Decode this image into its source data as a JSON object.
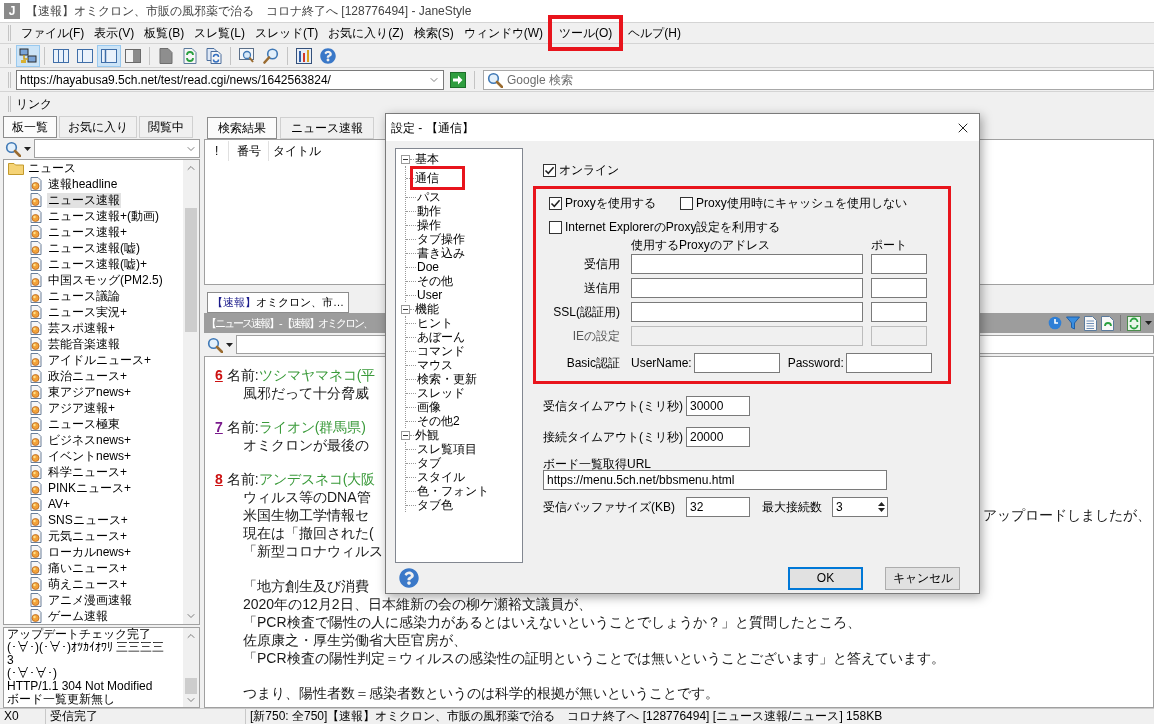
{
  "window": {
    "icon_letter": "J",
    "title": "【速報】オミクロン、市販の風邪薬で治る　コロナ終了へ [128776494] - JaneStyle"
  },
  "menu": [
    {
      "label": "ファイル(F)",
      "highlighted": false
    },
    {
      "label": "表示(V)",
      "highlighted": false
    },
    {
      "label": "板覧(B)",
      "highlighted": false
    },
    {
      "label": "スレ覧(L)",
      "highlighted": false
    },
    {
      "label": "スレッド(T)",
      "highlighted": false
    },
    {
      "label": "お気に入り(Z)",
      "highlighted": false
    },
    {
      "label": "検索(S)",
      "highlighted": false
    },
    {
      "label": "ウィンドウ(W)",
      "highlighted": false
    },
    {
      "label": "ツール(O)",
      "highlighted": true
    },
    {
      "label": "ヘルプ(H)",
      "highlighted": false
    }
  ],
  "toolbar": [
    [
      {
        "kind": "connect",
        "pressed": true
      }
    ],
    [
      {
        "kind": "three-pane",
        "pressed": false
      },
      {
        "kind": "two-pane",
        "pressed": false
      },
      {
        "kind": "pane",
        "pressed": true
      },
      {
        "kind": "split",
        "pressed": false
      }
    ],
    [
      {
        "kind": "document",
        "pressed": false
      },
      {
        "kind": "reload",
        "pressed": false
      },
      {
        "kind": "reload-all",
        "pressed": false
      }
    ],
    [
      {
        "kind": "window-search",
        "pressed": false
      },
      {
        "kind": "search",
        "pressed": false
      }
    ],
    [
      {
        "kind": "bars",
        "pressed": false
      },
      {
        "kind": "help",
        "pressed": false
      }
    ]
  ],
  "address": {
    "url": "https://hayabusa9.5ch.net/test/read.cgi/news/1642563824/"
  },
  "search": {
    "placeholder": "Google 検索"
  },
  "links_bar": {
    "label": "リンク"
  },
  "sidebar": {
    "tabs": [
      {
        "label": "板一覧",
        "selected": true
      },
      {
        "label": "お気に入り",
        "selected": false
      },
      {
        "label": "閲覧中",
        "selected": false
      }
    ],
    "tree": {
      "label": "ニュース",
      "children": [
        {
          "label": "速報headline",
          "selected": false
        },
        {
          "label": "ニュース速報",
          "selected": true
        },
        {
          "label": "ニュース速報+(動画)",
          "selected": false
        },
        {
          "label": "ニュース速報+",
          "selected": false
        },
        {
          "label": "ニュース速報(嘘)",
          "selected": false
        },
        {
          "label": "ニュース速報(嘘)+",
          "selected": false
        },
        {
          "label": "中国スモッグ(PM2.5)",
          "selected": false
        },
        {
          "label": "ニュース議論",
          "selected": false
        },
        {
          "label": "ニュース実況+",
          "selected": false
        },
        {
          "label": "芸スポ速報+",
          "selected": false
        },
        {
          "label": "芸能音楽速報",
          "selected": false
        },
        {
          "label": "アイドルニュース+",
          "selected": false
        },
        {
          "label": "政治ニュース+",
          "selected": false
        },
        {
          "label": "東アジアnews+",
          "selected": false
        },
        {
          "label": "アジア速報+",
          "selected": false
        },
        {
          "label": "ニュース極東",
          "selected": false
        },
        {
          "label": "ビジネスnews+",
          "selected": false
        },
        {
          "label": "イベントnews+",
          "selected": false
        },
        {
          "label": "科学ニュース+",
          "selected": false
        },
        {
          "label": "PINKニュース+",
          "selected": false
        },
        {
          "label": "AV+",
          "selected": false
        },
        {
          "label": "SNSニュース+",
          "selected": false
        },
        {
          "label": "元気ニュース+",
          "selected": false
        },
        {
          "label": "ローカルnews+",
          "selected": false
        },
        {
          "label": "痛いニュース+",
          "selected": false
        },
        {
          "label": "萌えニュース+",
          "selected": false
        },
        {
          "label": "アニメ漫画速報",
          "selected": false
        },
        {
          "label": "ゲーム速報",
          "selected": false
        }
      ]
    },
    "log": [
      "アップデートチェック完了",
      "(･∀･)(･∀･)ｵﾂｶｲｵﾜﾘ 三三三三",
      "3",
      "(･∀･∀･)",
      "HTTP/1.1 304 Not Modified",
      "ボード一覧更新無し"
    ]
  },
  "threads_pane": {
    "tabs": [
      {
        "label": "検索結果",
        "selected": true
      },
      {
        "label": "ニュース速報",
        "selected": false
      }
    ],
    "columns": [
      "!",
      "番号",
      "タイトル"
    ]
  },
  "thread": {
    "tab": {
      "tag": "【速報】",
      "label": "オミクロン、市…",
      "selected": true
    },
    "header": "【ニュース速報】 - 【速報】オミクロン、",
    "posts": [
      {
        "number": "6",
        "color": "#cc1111",
        "name_label": "名前:",
        "name": "ツシマヤマネコ(平",
        "paragraphs": [
          [
            {
              "text": "風邪だって十分脅威"
            }
          ]
        ]
      },
      {
        "number": "7",
        "color": "#7a1a8c",
        "name_label": "名前:",
        "name": "ライオン(群馬県)",
        "paragraphs": [
          [
            {
              "text": "オミクロンが最後の"
            }
          ]
        ]
      },
      {
        "number": "8",
        "color": "#cc1111",
        "name_label": "名前:",
        "name": "アンデスネコ(大阪",
        "paragraphs": [
          [
            {
              "text": "ウィルス等のDNA管"
            },
            {
              "text": "米国生物工学情報セ",
              "tail": "アップロードしましたが、"
            },
            {
              "text": "現在は「撤回された("
            },
            {
              "text": "「新型コロナウィルス"
            }
          ],
          [
            {
              "text": "「地方創生及び消費"
            },
            {
              "text": "2020年の12月2日、日本維新の会の柳ケ瀬裕文議員が、"
            },
            {
              "text": "「PCR検査で陽性の人に感染力があるとはいえないということでしょうか？」と質問したところ、"
            },
            {
              "text": "佐原康之・厚生労働省大臣官房が、"
            },
            {
              "text": "「PCR検査の陽性判定＝ウィルスの感染性の証明ということでは無いということございます」と答えています。"
            }
          ],
          [
            {
              "text": "つまり、陽性者数＝感染者数というのは科学的根拠が無いということです。"
            }
          ]
        ]
      }
    ]
  },
  "status_bar": [
    "X0",
    "受信完了",
    "[新750: 全750]【速報】オミクロン、市販の風邪薬で治る　コロナ終了へ [128776494] [ニュース速報/ニュース]  158KB"
  ],
  "dialog": {
    "title": "設定 - 【通信】",
    "tree": [
      {
        "label": "基本",
        "expanded": true,
        "children": [
          {
            "label": "通信",
            "highlighted": true
          },
          {
            "label": "パス",
            "highlighted": false
          },
          {
            "label": "動作",
            "highlighted": false
          },
          {
            "label": "操作",
            "highlighted": false
          },
          {
            "label": "タブ操作",
            "highlighted": false
          },
          {
            "label": "書き込み",
            "highlighted": false
          },
          {
            "label": "Doe",
            "highlighted": false
          },
          {
            "label": "その他",
            "highlighted": false
          },
          {
            "label": "User",
            "highlighted": false
          }
        ]
      },
      {
        "label": "機能",
        "expanded": true,
        "children": [
          {
            "label": "ヒント",
            "highlighted": false
          },
          {
            "label": "あぼーん",
            "highlighted": false
          },
          {
            "label": "コマンド",
            "highlighted": false
          },
          {
            "label": "マウス",
            "highlighted": false
          },
          {
            "label": "検索・更新",
            "highlighted": false
          },
          {
            "label": "スレッド",
            "highlighted": false
          },
          {
            "label": "画像",
            "highlighted": false
          },
          {
            "label": "その他2",
            "highlighted": false
          }
        ]
      },
      {
        "label": "外観",
        "expanded": true,
        "children": [
          {
            "label": "スレ覧項目",
            "highlighted": false
          },
          {
            "label": "タブ",
            "highlighted": false
          },
          {
            "label": "スタイル",
            "highlighted": false
          },
          {
            "label": "色・フォント",
            "highlighted": false
          },
          {
            "label": "タブ色",
            "highlighted": false
          }
        ]
      }
    ],
    "online": {
      "label": "オンライン",
      "checked": true
    },
    "proxy": {
      "highlighted": true,
      "use_proxy": {
        "label": "Proxyを使用する",
        "checked": true
      },
      "no_cache": {
        "label": "Proxy使用時にキャッシュを使用しない",
        "checked": false
      },
      "use_ie": {
        "label": "Internet ExplorerのProxy設定を利用する",
        "checked": false
      },
      "address_header": "使用するProxyのアドレス",
      "port_header": "ポート",
      "rows": [
        {
          "label": "受信用",
          "disabled": false
        },
        {
          "label": "送信用",
          "disabled": false
        },
        {
          "label": "SSL(認証用)",
          "disabled": false
        },
        {
          "label": "IEの設定",
          "disabled": true
        }
      ],
      "basic_auth": {
        "label": "Basic認証",
        "username_label": "UserName:",
        "password_label": "Password:"
      }
    },
    "receive_timeout": {
      "label": "受信タイムアウト(ミリ秒)",
      "value": "30000"
    },
    "connect_timeout": {
      "label": "接続タイムアウト(ミリ秒)",
      "value": "20000"
    },
    "board_url": {
      "label": "ボード一覧取得URL",
      "value": "https://menu.5ch.net/bbsmenu.html"
    },
    "buffer_size": {
      "label": "受信バッファサイズ(KB)",
      "value": "32"
    },
    "max_connections": {
      "label": "最大接続数",
      "value": "3"
    },
    "buttons": [
      {
        "label": "OK",
        "default": true
      },
      {
        "label": "キャンセル",
        "default": false
      }
    ]
  }
}
